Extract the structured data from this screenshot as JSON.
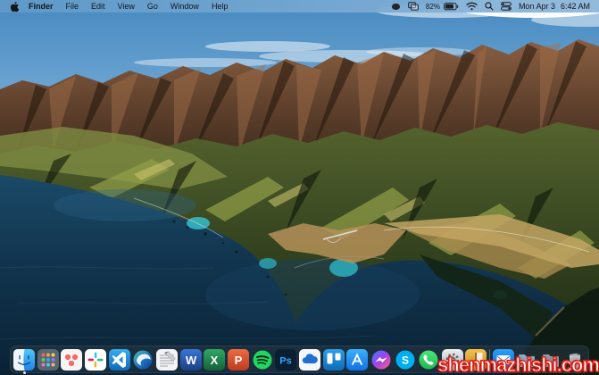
{
  "menu_bar": {
    "apple_logo": "apple-icon",
    "menus": [
      "Finder",
      "File",
      "Edit",
      "View",
      "Go",
      "Window",
      "Help"
    ],
    "status": {
      "battery_percent": "82%",
      "date": "Mon Apr 3",
      "time": "6:42 AM",
      "icons": [
        "menu-extra",
        "screen-mirroring",
        "battery",
        "wifi",
        "spotlight",
        "control-center"
      ]
    }
  },
  "dock": {
    "apps": [
      "finder",
      "launchpad",
      "asana",
      "slack",
      "vscode",
      "edge",
      "textedit",
      "word",
      "excel",
      "powerpoint",
      "spotify",
      "photoshop",
      "onedrive",
      "trello",
      "app-store",
      "messenger",
      "skype",
      "whatsapp",
      "system-settings",
      "dictionary",
      "mail",
      "folder-1",
      "folder-2",
      "trash"
    ]
  },
  "watermark": {
    "text": "shenmazhishi.com",
    "fill": "#ffffff",
    "outline": "#d81f16"
  },
  "wallpaper": {
    "name": "macOS Big Sur coastline",
    "sky": "#5b9bcb",
    "ocean": "#0e2c44",
    "mountain_green": "#3f511f",
    "ridge_brown": "#7c5138",
    "cove_turquoise": "#35c6d4"
  }
}
